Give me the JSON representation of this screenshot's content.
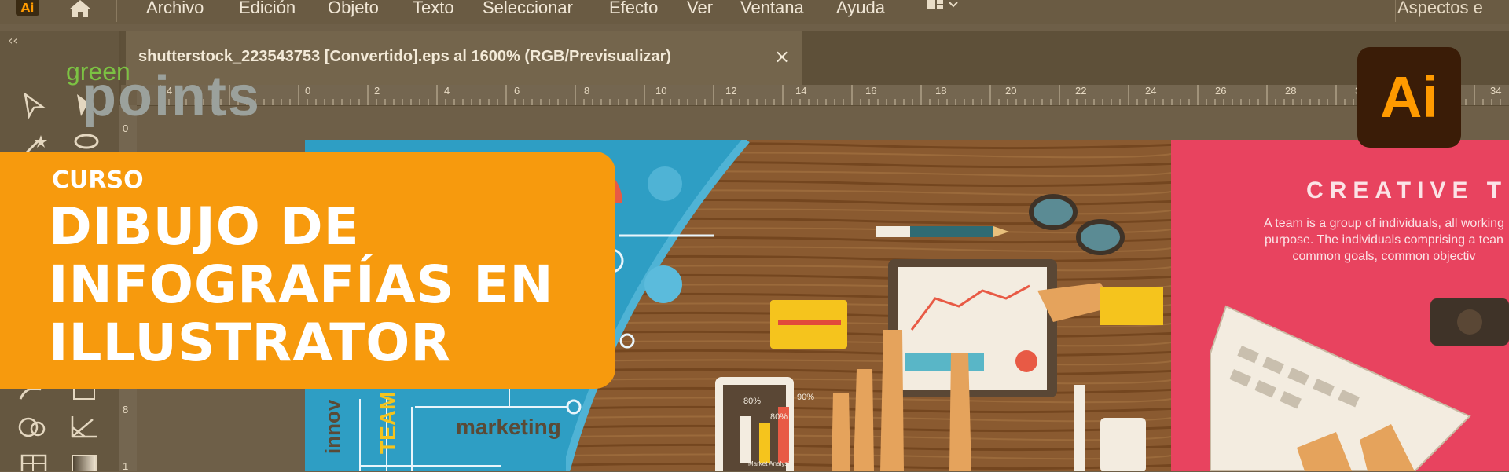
{
  "app": {
    "badge": "Ai"
  },
  "menu": {
    "items": [
      "Archivo",
      "Edición",
      "Objeto",
      "Texto",
      "Seleccionar",
      "Efecto",
      "Ver",
      "Ventana",
      "Ayuda"
    ],
    "workspace": "Aspectos e"
  },
  "document": {
    "tab_title": "shutterstock_223543753 [Convertido].eps al 1600% (RGB/Previsualizar)",
    "close": "×"
  },
  "ruler": {
    "horizontal": [
      "4",
      "0",
      "2",
      "4",
      "6",
      "8",
      "10",
      "12",
      "14",
      "16",
      "18",
      "20",
      "22",
      "24",
      "26",
      "28",
      "3",
      "34"
    ],
    "vertical": [
      "0",
      "8",
      "1"
    ]
  },
  "toolbar": {
    "collapse": "‹‹"
  },
  "logo": {
    "top": "green",
    "bottom": "points"
  },
  "banner": {
    "kicker": "CURSO",
    "title_lines": [
      "DIBUJO DE",
      "INFOGRAFÍAS EN",
      "ILLUSTRATOR"
    ]
  },
  "artwork": {
    "heading": "CREATIVE T",
    "paragraph": "A team is a group of individuals, all working purpose. The individuals comprising a tean common goals, common objectiv",
    "marketing": "marketing",
    "team": "TEAM",
    "innov": "innov",
    "percents": [
      "80%",
      "80%",
      "90%"
    ],
    "tablet_caption": "Market Analysis"
  },
  "colors": {
    "accent": "#f79a0d",
    "ai": "#ff9a00",
    "ai_bg": "#3a1c07",
    "pink": "#e8435f",
    "blue": "#2e9ec4"
  }
}
